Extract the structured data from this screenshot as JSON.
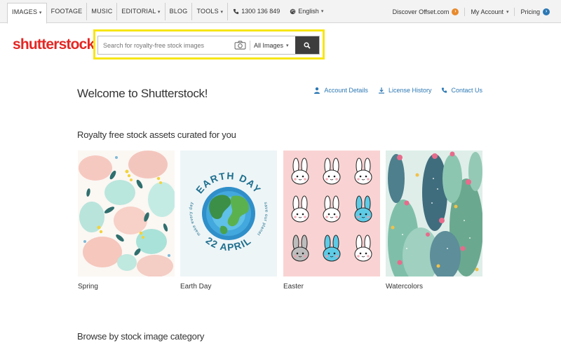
{
  "nav": {
    "tabs": [
      {
        "label": "IMAGES"
      },
      {
        "label": "FOOTAGE"
      },
      {
        "label": "MUSIC"
      },
      {
        "label": "EDITORIAL"
      },
      {
        "label": "BLOG"
      },
      {
        "label": "TOOLS"
      }
    ],
    "phone": "1300 136 849",
    "language": "English",
    "right": {
      "offset": "Discover Offset.com",
      "account": "My Account",
      "pricing": "Pricing"
    }
  },
  "logo": {
    "text": "shutterstock"
  },
  "search": {
    "placeholder": "Search for royalty-free stock images",
    "filter": "All Images"
  },
  "welcome": {
    "title": "Welcome to Shutterstock!",
    "links": [
      {
        "label": "Account Details"
      },
      {
        "label": "License History"
      },
      {
        "label": "Contact Us"
      }
    ]
  },
  "curated": {
    "title": "Royalty free stock assets curated for you",
    "cards": [
      {
        "caption": "Spring"
      },
      {
        "caption": "Earth Day",
        "art_top": "EARTH DAY",
        "art_left": "make every day",
        "art_right": "save our planet",
        "art_bottom": "22 APRIL"
      },
      {
        "caption": "Easter"
      },
      {
        "caption": "Watercolors"
      }
    ]
  },
  "browse": {
    "title": "Browse by stock image category"
  },
  "colors": {
    "brand": "#e42623",
    "link": "#2c78b4",
    "highlight": "#f7e614"
  }
}
